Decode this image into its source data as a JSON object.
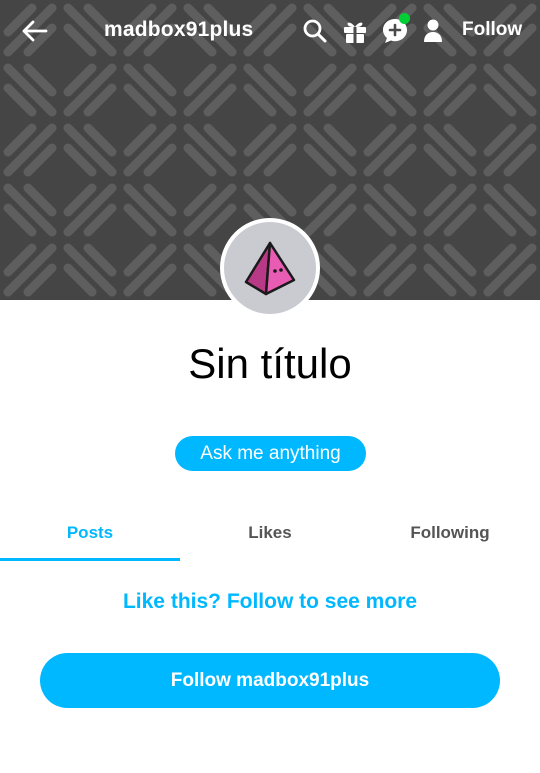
{
  "header": {
    "blog_name": "madbox91plus",
    "follow_label": "Follow",
    "icons": [
      "back-arrow-icon",
      "search-icon",
      "gift-icon",
      "chat-add-icon",
      "person-icon"
    ],
    "notification_color": "#00cf35"
  },
  "profile": {
    "title": "Sin título",
    "ask_label": "Ask me anything",
    "avatar": "pink-pyramid-avatar"
  },
  "tabs": [
    {
      "label": "Posts",
      "active": true
    },
    {
      "label": "Likes",
      "active": false
    },
    {
      "label": "Following",
      "active": false
    }
  ],
  "cta": {
    "text": "Like this? Follow to see more",
    "button_label": "Follow madbox91plus"
  },
  "colors": {
    "accent": "#00b8ff",
    "banner": "#4a4a4a",
    "avatar_bg": "#c9cbd1",
    "pyramid": "#e24ea6"
  }
}
